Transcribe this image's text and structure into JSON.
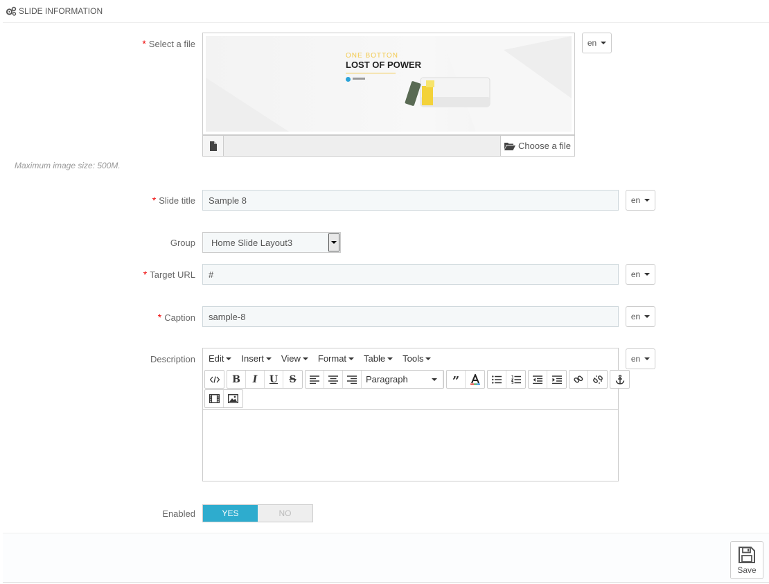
{
  "panel": {
    "title": "SLIDE INFORMATION"
  },
  "file": {
    "label": "Select a file",
    "lang": "en",
    "preview": {
      "subtitle": "ONE BOTTON",
      "title": "LOST OF POWER"
    },
    "choose_label": "Choose a file",
    "help": "Maximum image size: 500M."
  },
  "slide_title": {
    "label": "Slide title",
    "value": "Sample 8",
    "lang": "en"
  },
  "group": {
    "label": "Group",
    "value": "Home Slide Layout3"
  },
  "target_url": {
    "label": "Target URL",
    "value": "#",
    "lang": "en"
  },
  "caption": {
    "label": "Caption",
    "value": "sample-8",
    "lang": "en"
  },
  "description": {
    "label": "Description",
    "lang": "en",
    "menu": [
      "Edit",
      "Insert",
      "View",
      "Format",
      "Table",
      "Tools"
    ],
    "block_format": "Paragraph"
  },
  "enabled": {
    "label": "Enabled",
    "yes": "YES",
    "no": "NO",
    "value": "yes"
  },
  "footer": {
    "save_label": "Save"
  },
  "colors": {
    "accent": "#2eacce",
    "required": "#e00000"
  }
}
